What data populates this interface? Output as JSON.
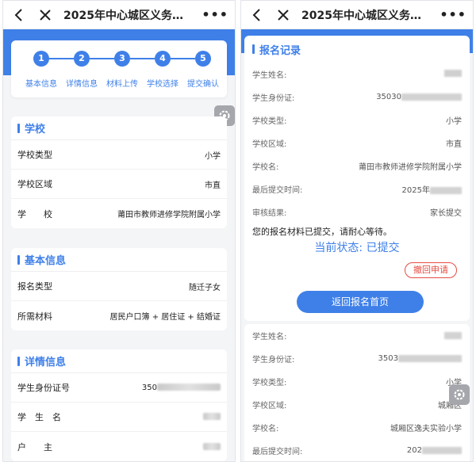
{
  "left": {
    "header": {
      "title": "2025年中心城区义务…",
      "more": "•••"
    },
    "steps": [
      {
        "num": "1",
        "label": "基本信息"
      },
      {
        "num": "2",
        "label": "详情信息"
      },
      {
        "num": "3",
        "label": "材料上传"
      },
      {
        "num": "4",
        "label": "学校选择"
      },
      {
        "num": "5",
        "label": "提交确认"
      }
    ],
    "school": {
      "title": "学校",
      "rows": [
        {
          "key": "学校类型",
          "value": "小学"
        },
        {
          "key": "学校区域",
          "value": "市直"
        },
        {
          "key": "学　　校",
          "value": "莆田市教师进修学院附属小学"
        }
      ]
    },
    "basic": {
      "title": "基本信息",
      "rows": [
        {
          "key": "报名类型",
          "value": "随迁子女"
        },
        {
          "key": "所需材料",
          "value": "居民户口簿 + 居住证 + 结婚证"
        }
      ]
    },
    "detail": {
      "title": "详情信息",
      "rows": [
        {
          "key": "学生身份证号",
          "value": "350"
        },
        {
          "key": "学　生　名",
          "value": ""
        },
        {
          "key": "户　　主",
          "value": ""
        }
      ]
    }
  },
  "right": {
    "header": {
      "title": "2025年中心城区义务…",
      "more": "•••"
    },
    "record": {
      "title": "报名记录",
      "rows": [
        {
          "key": "学生姓名:",
          "value": ""
        },
        {
          "key": "学生身份证:",
          "value": "35030"
        },
        {
          "key": "学校类型:",
          "value": "小学"
        },
        {
          "key": "学校区域:",
          "value": "市直"
        },
        {
          "key": "学校名:",
          "value": "莆田市教师进修学院附属小学"
        },
        {
          "key": "最后提交时间:",
          "value": "2025年"
        },
        {
          "key": "审核结果:",
          "value": "家长提交"
        }
      ],
      "notice": "您的报名材料已提交，请耐心等待。",
      "status": "当前状态: 已提交",
      "withdraw": "撤回申请",
      "return_button": "返回报名首页"
    },
    "record2": {
      "rows": [
        {
          "key": "学生姓名:",
          "value": ""
        },
        {
          "key": "学生身份证:",
          "value": "3503"
        },
        {
          "key": "学校类型:",
          "value": "小学"
        },
        {
          "key": "学校区域:",
          "value": "城厢区"
        },
        {
          "key": "学校名:",
          "value": "城厢区逸夫实验小学"
        },
        {
          "key": "最后提交时间:",
          "value": "202"
        }
      ]
    }
  },
  "colors": {
    "accent": "#3f80e8",
    "danger": "#e54d42",
    "background": "#f4f5f7"
  },
  "icons": {
    "back": "chevron-left-icon",
    "close": "close-icon",
    "more": "more-dots-icon",
    "settings": "gear-icon"
  }
}
